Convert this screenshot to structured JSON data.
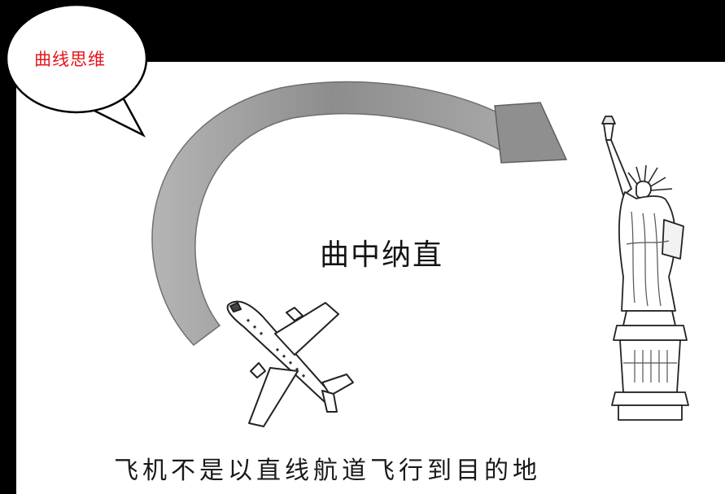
{
  "bubble": {
    "text": "曲线思维"
  },
  "diagram": {
    "center_label": "曲中纳直",
    "caption": "飞机不是以直线航道飞行到目的地"
  },
  "colors": {
    "background": "#000000",
    "panel": "#ffffff",
    "bubble_text": "#e8141c",
    "arrow_fill": "#9a9a9a"
  },
  "icons": {
    "airplane": "airplane-icon",
    "statue": "statue-of-liberty-icon",
    "arrow": "curved-arrow-icon"
  }
}
